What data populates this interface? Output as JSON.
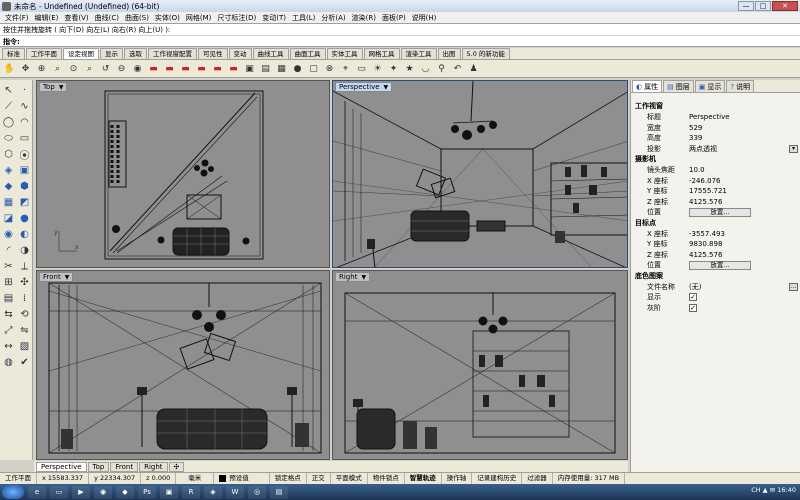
{
  "window": {
    "title": "未命名 - Undefined (Undefined) (64-bit)",
    "controls": [
      "—",
      "□",
      "✕"
    ]
  },
  "menu": [
    "文件(F)",
    "编辑(E)",
    "查看(V)",
    "曲线(C)",
    "曲面(S)",
    "实体(O)",
    "网格(M)",
    "尺寸标注(D)",
    "变动(T)",
    "工具(L)",
    "分析(A)",
    "渲染(R)",
    "面板(P)",
    "说明(H)"
  ],
  "command": {
    "history": "按住并拖拽旋转 ( 向下(D) 向左(L) 向右(R) 向上(U) ):",
    "prompt": "指令:"
  },
  "toolbar_tabs": [
    "标准",
    "工作平面",
    "设定视图",
    "显示",
    "选取",
    "工作视窗配置",
    "可见性",
    "变动",
    "曲线工具",
    "曲面工具",
    "实体工具",
    "网格工具",
    "渲染工具",
    "出图",
    "5.0 的新功能"
  ],
  "active_toolbar_tab": 2,
  "icons": {
    "top_toolbar": [
      {
        "name": "pan-hand-icon",
        "glyph": "✋"
      },
      {
        "name": "move-icon",
        "glyph": "✥"
      },
      {
        "name": "zoom-window-icon",
        "glyph": "⊕"
      },
      {
        "name": "zoom-extents-icon",
        "glyph": "⌕"
      },
      {
        "name": "zoom-selected-icon",
        "glyph": "⊙"
      },
      {
        "name": "zoom-icon",
        "glyph": "⌕"
      },
      {
        "name": "rotate-view-icon",
        "glyph": "↺"
      },
      {
        "name": "zoom-out-icon",
        "glyph": "⊖"
      },
      {
        "name": "camera-icon",
        "glyph": "◉"
      },
      {
        "name": "car-icon-1",
        "glyph": "▬"
      },
      {
        "name": "car-icon-2",
        "glyph": "▬"
      },
      {
        "name": "car-icon-3",
        "glyph": "▬"
      },
      {
        "name": "car-icon-4",
        "glyph": "▬"
      },
      {
        "name": "car-icon-5",
        "glyph": "▬"
      },
      {
        "name": "car-icon-6",
        "glyph": "▬"
      },
      {
        "name": "display-mode-icon",
        "glyph": "▣"
      },
      {
        "name": "photo-icon",
        "glyph": "▤"
      },
      {
        "name": "grid-icon",
        "glyph": "▦"
      },
      {
        "name": "sphere-icon",
        "glyph": "●"
      },
      {
        "name": "view-cube-icon",
        "glyph": "▢"
      },
      {
        "name": "camera-target-icon",
        "glyph": "⊗"
      },
      {
        "name": "snap-icon",
        "glyph": "⌖"
      },
      {
        "name": "plan-view-icon",
        "glyph": "▭"
      },
      {
        "name": "sun-icon",
        "glyph": "☀"
      },
      {
        "name": "light-icon",
        "glyph": "✦"
      },
      {
        "name": "star-icon",
        "glyph": "★"
      },
      {
        "name": "bowl-icon",
        "glyph": "◡"
      },
      {
        "name": "walk-icon",
        "glyph": "⚲"
      },
      {
        "name": "undo-icon",
        "glyph": "↶"
      },
      {
        "name": "person-icon",
        "glyph": "♟"
      }
    ],
    "left_toolbar": [
      {
        "name": "select-arrow-icon",
        "glyph": "↖"
      },
      {
        "name": "point-icon",
        "glyph": "·"
      },
      {
        "name": "polyline-icon",
        "glyph": "⟋"
      },
      {
        "name": "curve-icon",
        "glyph": "∿"
      },
      {
        "name": "circle-icon",
        "glyph": "◯"
      },
      {
        "name": "arc-icon",
        "glyph": "◠"
      },
      {
        "name": "ellipse-icon",
        "glyph": "⬭"
      },
      {
        "name": "rectangle-icon",
        "glyph": "▭"
      },
      {
        "name": "polygon-icon",
        "glyph": "⬡"
      },
      {
        "name": "text-curve-icon",
        "glyph": "⦿"
      },
      {
        "name": "surface-icon",
        "glyph": "◈"
      },
      {
        "name": "box-icon",
        "glyph": "▣"
      },
      {
        "name": "solid-icon",
        "glyph": "◆"
      },
      {
        "name": "extrude-icon",
        "glyph": "⬢"
      },
      {
        "name": "mesh-icon",
        "glyph": "▦"
      },
      {
        "name": "sweep-icon",
        "glyph": "◩"
      },
      {
        "name": "network-surface-icon",
        "glyph": "◪"
      },
      {
        "name": "sphere-tool-icon",
        "glyph": "●"
      },
      {
        "name": "cylinder-icon",
        "glyph": "◉"
      },
      {
        "name": "boolean-icon",
        "glyph": "◐"
      },
      {
        "name": "fillet-icon",
        "glyph": "◜"
      },
      {
        "name": "offset-icon",
        "glyph": "◑"
      },
      {
        "name": "trim-icon",
        "glyph": "✂"
      },
      {
        "name": "split-icon",
        "glyph": "⟂"
      },
      {
        "name": "join-icon",
        "glyph": "⊞"
      },
      {
        "name": "explode-icon",
        "glyph": "✣"
      },
      {
        "name": "group-icon",
        "glyph": "▤"
      },
      {
        "name": "array-icon",
        "glyph": "⁞"
      },
      {
        "name": "move-tool-icon",
        "glyph": "⇆"
      },
      {
        "name": "rotate-tool-icon",
        "glyph": "⟲"
      },
      {
        "name": "scale-icon",
        "glyph": "⤢"
      },
      {
        "name": "mirror-icon",
        "glyph": "⇋"
      },
      {
        "name": "dimension-icon",
        "glyph": "↔"
      },
      {
        "name": "hatch-icon",
        "glyph": "▧"
      },
      {
        "name": "render-icon",
        "glyph": "◍"
      },
      {
        "name": "analyze-icon",
        "glyph": "✔"
      }
    ]
  },
  "viewports": {
    "top": {
      "label": "Top"
    },
    "perspective": {
      "label": "Perspective"
    },
    "front": {
      "label": "Front"
    },
    "right": {
      "label": "Right"
    }
  },
  "view_tabs": [
    "Perspective",
    "Top",
    "Front",
    "Right"
  ],
  "view_tab_add": "✣",
  "properties": {
    "tabs": [
      {
        "label": "属性",
        "icon": "properties-icon",
        "glyph": "◐"
      },
      {
        "label": "图层",
        "icon": "layers-icon",
        "glyph": "▤"
      },
      {
        "label": "显示",
        "icon": "display-icon",
        "glyph": "▣"
      },
      {
        "label": "说明",
        "icon": "help-icon",
        "glyph": "?"
      }
    ],
    "section_viewport": "工作视窗",
    "viewport_rows": [
      {
        "key": "标题",
        "value": "Perspective"
      },
      {
        "key": "宽度",
        "value": "529"
      },
      {
        "key": "高度",
        "value": "339"
      },
      {
        "key": "投影",
        "value": "两点透视"
      }
    ],
    "section_camera": "摄影机",
    "camera_rows": [
      {
        "key": "镜头焦距",
        "value": "10.0"
      },
      {
        "key": "X 座标",
        "value": "-246.076"
      },
      {
        "key": "Y 座标",
        "value": "17555.721"
      },
      {
        "key": "Z 座标",
        "value": "4125.576"
      }
    ],
    "camera_position_key": "位置",
    "place_button": "放置...",
    "section_target": "目标点",
    "target_rows": [
      {
        "key": "X 座标",
        "value": "-3557.493"
      },
      {
        "key": "Y 座标",
        "value": "9830.898"
      },
      {
        "key": "Z 座标",
        "value": "4125.576"
      }
    ],
    "target_position_key": "位置",
    "section_wallpaper": "底色图案",
    "wallpaper_file_key": "文件名称",
    "wallpaper_file_value": "(无)",
    "wallpaper_show_key": "显示",
    "wallpaper_gray_key": "灰阶",
    "checkmark": "✓",
    "more_button": "...",
    "dropdown_arrow": "▾"
  },
  "status": {
    "cplane": "工作平面",
    "x": "x 15583.337",
    "y": "y 22334.307",
    "z": "z 0.000",
    "units": "毫米",
    "layer": "预设值",
    "items": [
      "锁定格点",
      "正交",
      "平面模式",
      "物件锁点",
      "智慧轨迹",
      "操作轴",
      "记录建构历史",
      "过滤器"
    ],
    "bold_item": "智慧轨迹",
    "memory": "内存使用量: 317 MB"
  },
  "taskbar": {
    "apps": [
      {
        "name": "ie-icon",
        "glyph": "e"
      },
      {
        "name": "folder-icon",
        "glyph": "▭"
      },
      {
        "name": "media-icon",
        "glyph": "▶"
      },
      {
        "name": "chrome-icon",
        "glyph": "◉"
      },
      {
        "name": "app-icon-5",
        "glyph": "◆"
      },
      {
        "name": "photoshop-icon",
        "glyph": "Ps"
      },
      {
        "name": "app-icon-7",
        "glyph": "▣"
      },
      {
        "name": "rhino-icon",
        "glyph": "R"
      },
      {
        "name": "app-icon-9",
        "glyph": "◈"
      },
      {
        "name": "word-icon",
        "glyph": "W"
      },
      {
        "name": "app-icon-11",
        "glyph": "◎"
      },
      {
        "name": "app-icon-12",
        "glyph": "▤"
      }
    ],
    "tray_text": "CH ▲ ✉ 16:40"
  }
}
